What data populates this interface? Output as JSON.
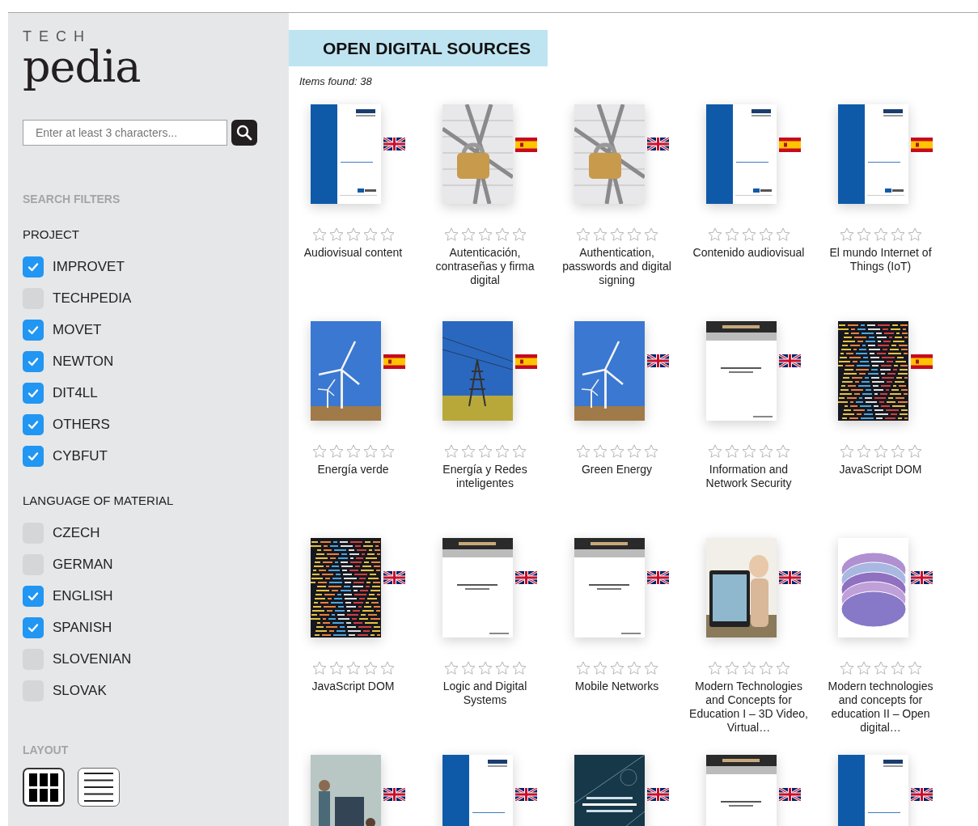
{
  "logo": {
    "small": "TECH",
    "large": "pedia"
  },
  "search": {
    "placeholder": "Enter at least 3 characters..."
  },
  "filters_heading": "SEARCH FILTERS",
  "filter_groups": [
    {
      "title": "PROJECT",
      "options": [
        {
          "label": "IMPROVET",
          "checked": true
        },
        {
          "label": "TECHPEDIA",
          "checked": false
        },
        {
          "label": "MOVET",
          "checked": true
        },
        {
          "label": "NEWTON",
          "checked": true
        },
        {
          "label": "DIT4LL",
          "checked": true
        },
        {
          "label": "OTHERS",
          "checked": true
        },
        {
          "label": "CYBFUT",
          "checked": true
        }
      ]
    },
    {
      "title": "LANGUAGE OF MATERIAL",
      "options": [
        {
          "label": "CZECH",
          "checked": false
        },
        {
          "label": "GERMAN",
          "checked": false
        },
        {
          "label": "ENGLISH",
          "checked": true
        },
        {
          "label": "SPANISH",
          "checked": true
        },
        {
          "label": "SLOVENIAN",
          "checked": false
        },
        {
          "label": "SLOVAK",
          "checked": false
        }
      ]
    }
  ],
  "layout": {
    "title": "LAYOUT",
    "options": [
      {
        "kind": "grid",
        "selected": true
      },
      {
        "kind": "list",
        "selected": false
      }
    ]
  },
  "page_title": "OPEN DIGITAL SOURCES",
  "items_found": "Items found: 38",
  "items": [
    {
      "cover": {
        "kind": "movet"
      },
      "flag": {
        "kind": "uk"
      },
      "stars": 0,
      "title": "Audiovisual content"
    },
    {
      "cover": {
        "kind": "lock"
      },
      "flag": {
        "kind": "es"
      },
      "stars": 0,
      "title": "Autenticación, contraseñas y firma digital"
    },
    {
      "cover": {
        "kind": "lock"
      },
      "flag": {
        "kind": "uk"
      },
      "stars": 0,
      "title": "Authentication, passwords and digital signing"
    },
    {
      "cover": {
        "kind": "movet"
      },
      "flag": {
        "kind": "es"
      },
      "stars": 0,
      "title": "Contenido audiovisual"
    },
    {
      "cover": {
        "kind": "movet"
      },
      "flag": {
        "kind": "es"
      },
      "stars": 0,
      "title": "El mundo Internet of Things (IoT)"
    },
    {
      "cover": {
        "kind": "wind"
      },
      "flag": {
        "kind": "es"
      },
      "stars": 0,
      "title": "Energía verde"
    },
    {
      "cover": {
        "kind": "pylon"
      },
      "flag": {
        "kind": "es"
      },
      "stars": 0,
      "title": "Energía y Redes inteligentes"
    },
    {
      "cover": {
        "kind": "wind"
      },
      "flag": {
        "kind": "uk"
      },
      "stars": 0,
      "title": "Green Energy"
    },
    {
      "cover": {
        "kind": "improvet"
      },
      "flag": {
        "kind": "uk"
      },
      "stars": 0,
      "title": "Information and Network Security"
    },
    {
      "cover": {
        "kind": "code"
      },
      "flag": {
        "kind": "es"
      },
      "stars": 0,
      "title": "JavaScript DOM"
    },
    {
      "cover": {
        "kind": "code"
      },
      "flag": {
        "kind": "uk"
      },
      "stars": 0,
      "title": "JavaScript DOM"
    },
    {
      "cover": {
        "kind": "improvet"
      },
      "flag": {
        "kind": "uk"
      },
      "stars": 0,
      "title": "Logic and Digital Systems"
    },
    {
      "cover": {
        "kind": "improvet"
      },
      "flag": {
        "kind": "uk"
      },
      "stars": 0,
      "title": "Mobile Networks"
    },
    {
      "cover": {
        "kind": "tablet"
      },
      "flag": {
        "kind": "uk"
      },
      "stars": 0,
      "title": "Modern Technologies and Concepts for Education I – 3D Video, Virtual…"
    },
    {
      "cover": {
        "kind": "discs"
      },
      "flag": {
        "kind": "uk"
      },
      "stars": 0,
      "title": "Modern technologies and concepts for education II – Open digital…"
    },
    {
      "cover": {
        "kind": "people"
      },
      "flag": {
        "kind": "uk"
      }
    },
    {
      "cover": {
        "kind": "movet"
      },
      "flag": {
        "kind": "uk"
      }
    },
    {
      "cover": {
        "kind": "network"
      },
      "flag": {
        "kind": "uk"
      }
    },
    {
      "cover": {
        "kind": "improvet"
      },
      "flag": {
        "kind": "uk"
      }
    },
    {
      "cover": {
        "kind": "movet"
      },
      "flag": {
        "kind": "uk"
      }
    }
  ]
}
